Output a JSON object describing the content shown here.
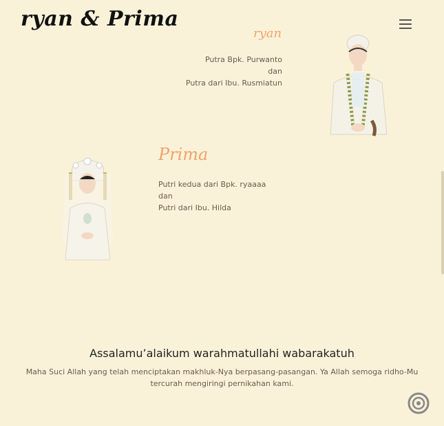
{
  "header": {
    "brand": "ryan & Prima",
    "menu_icon": "hamburger-menu-icon"
  },
  "groom": {
    "name": "ryan",
    "father_line": "Putra Bpk. Purwanto",
    "and": "dan",
    "mother_line": "Putra dari Ibu. Rusmiatun"
  },
  "bride": {
    "name": "Prima",
    "father_line": "Putri kedua dari Bpk. ryaaaa",
    "and": "dan",
    "mother_line": "Putri dari Ibu. Hilda"
  },
  "greeting": {
    "title": "Assalamu’alaikum warahmatullahi wabarakatuh",
    "line1": "Maha Suci Allah yang telah menciptakan makhluk-Nya berpasang-pasangan. Ya Allah semoga ridho-Mu",
    "line2": "tercurah mengiringi pernikahan kami."
  },
  "music_button": {
    "icon": "music-disc-icon"
  },
  "colors": {
    "background": "#faf2d8",
    "accent": "#f1a36b",
    "text": "#6b5a4a"
  }
}
